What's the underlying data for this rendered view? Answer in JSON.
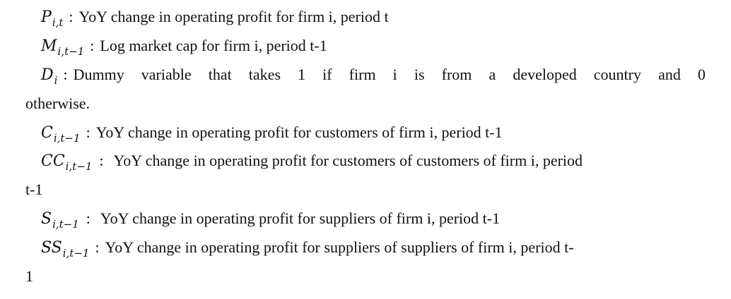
{
  "definitions": {
    "p": {
      "symbol": "P",
      "subscript": "i,t",
      "separator": ":",
      "text": "YoY change in operating profit for firm i, period t"
    },
    "m": {
      "symbol": "M",
      "subscript": "i,t−1",
      "separator": ":",
      "text": "Log market cap for firm i, period t-1"
    },
    "d": {
      "symbol": "D",
      "subscript": "i",
      "separator": ":",
      "words": [
        "Dummy",
        "variable",
        "that",
        "takes",
        "1",
        "if",
        "firm",
        "i",
        "is",
        "from",
        "a",
        "developed",
        "country",
        "and",
        "0"
      ],
      "continuation": "otherwise."
    },
    "c": {
      "symbol": "C",
      "subscript": "i,t−1",
      "separator": ":",
      "text": "YoY change in operating profit for customers of firm i, period t-1"
    },
    "cc": {
      "symbol": "CC",
      "subscript": "i,t−1",
      "separator": ":",
      "text": "YoY change in operating profit for customers of customers of firm i, period",
      "continuation": "t-1"
    },
    "s": {
      "symbol": "S",
      "subscript": "i,t−1",
      "separator": ":",
      "text": "YoY change in operating profit for suppliers of firm i, period t-1"
    },
    "ss": {
      "symbol": "SS",
      "subscript": "i,t−1",
      "separator": ":",
      "text": "YoY change in operating profit for suppliers of suppliers of firm i, period t-",
      "continuation": "1"
    }
  }
}
